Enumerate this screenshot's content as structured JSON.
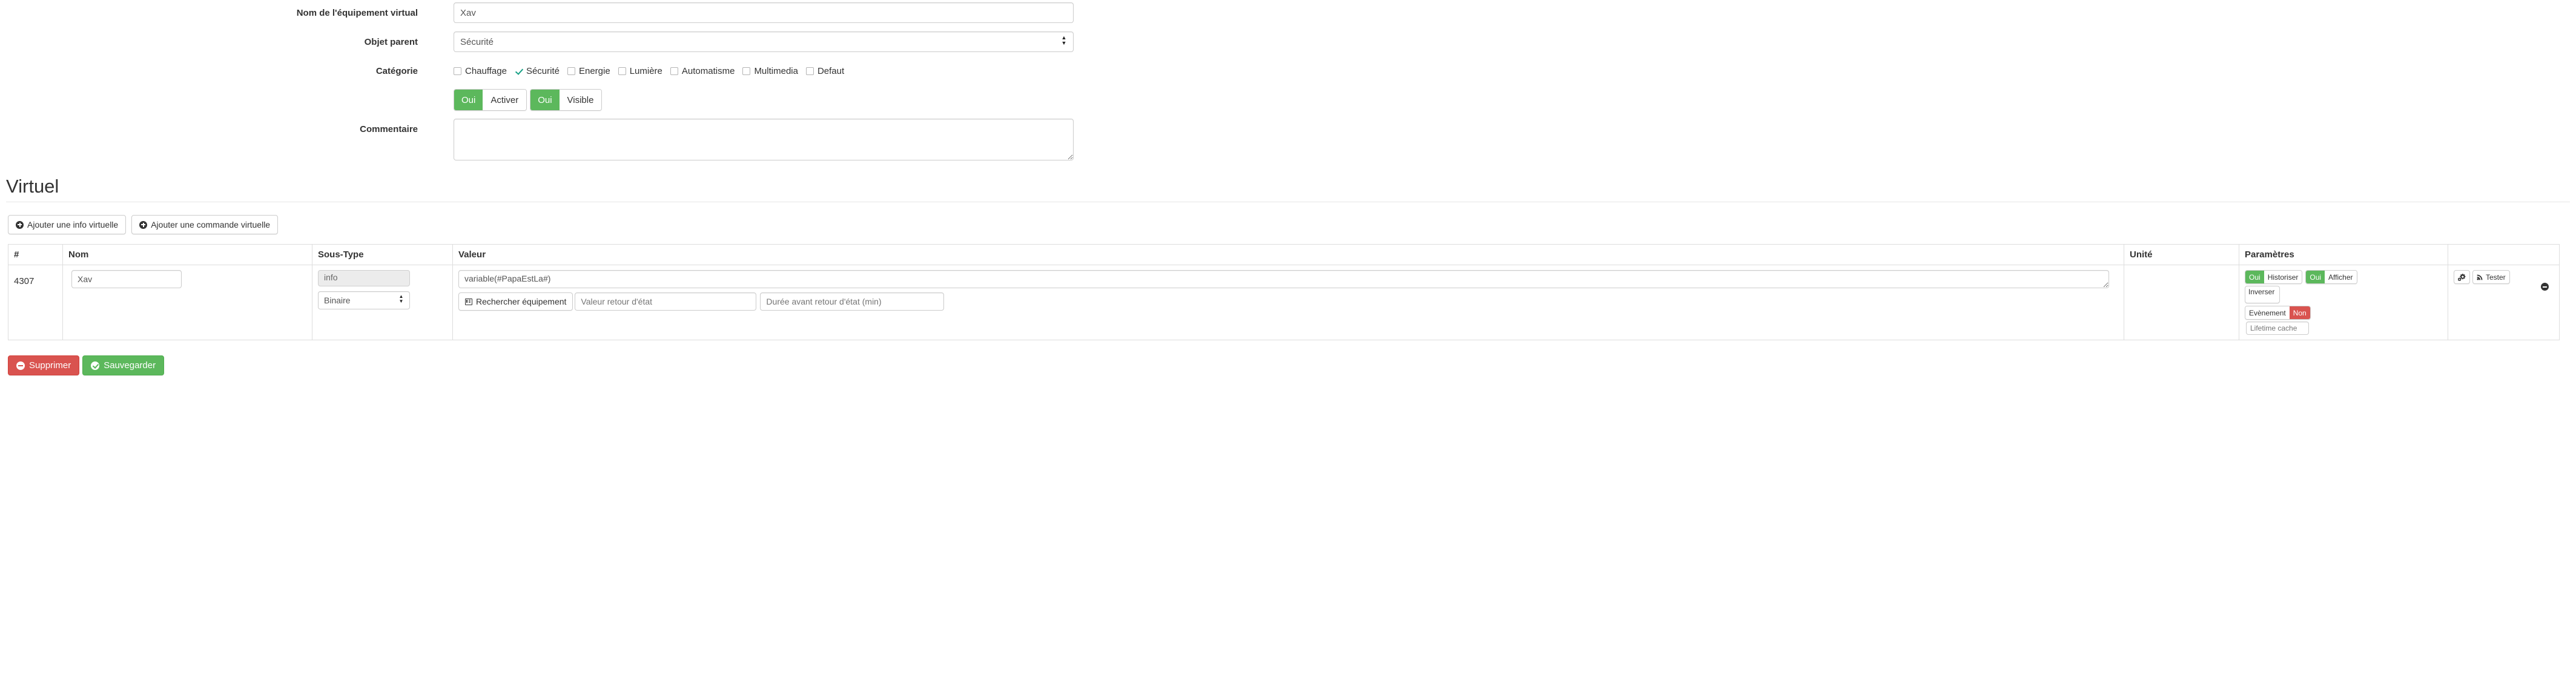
{
  "form": {
    "name_field": {
      "label": "Nom de l'équipement virtual",
      "value": "Xav",
      "placeholder": ""
    },
    "parent_field": {
      "label": "Objet parent",
      "value": "Sécurité"
    },
    "category_field": {
      "label": "Catégorie",
      "items": [
        {
          "label": "Chauffage",
          "checked": false
        },
        {
          "label": "Sécurité",
          "checked": true
        },
        {
          "label": "Energie",
          "checked": false
        },
        {
          "label": "Lumière",
          "checked": false
        },
        {
          "label": "Automatisme",
          "checked": false
        },
        {
          "label": "Multimedia",
          "checked": false
        },
        {
          "label": "Defaut",
          "checked": false
        }
      ]
    },
    "toggles": [
      {
        "state": "Oui",
        "label": "Activer"
      },
      {
        "state": "Oui",
        "label": "Visible"
      }
    ],
    "comment_field": {
      "label": "Commentaire",
      "value": "",
      "placeholder": ""
    }
  },
  "section": {
    "title": "Virtuel",
    "add_info_button": "Ajouter une info virtuelle",
    "add_command_button": "Ajouter une commande virtuelle"
  },
  "table": {
    "headers": [
      "#",
      "Nom",
      "Sous-Type",
      "Valeur",
      "Unité",
      "Paramètres",
      ""
    ],
    "rows": [
      {
        "id": "4307",
        "name": "Xav",
        "name_placeholder": "",
        "type_static": "info",
        "subtype": "Binaire",
        "value": "variable(#PapaEstLa#)",
        "search_button": "Rechercher équipement",
        "return_value_placeholder": "Valeur retour d'état",
        "duration_placeholder": "Durée avant retour d'état (min)",
        "unit": "",
        "params": {
          "historiser": {
            "state": "Oui",
            "label": "Historiser"
          },
          "afficher": {
            "state": "Oui",
            "label": "Afficher"
          },
          "inverser_label": "Inverser",
          "evenement": {
            "label": "Evènement",
            "state": "Non"
          },
          "lifetime_placeholder": "Lifetime cache"
        },
        "actions": {
          "config_icon": "gears-icon",
          "test_button": "Tester",
          "remove_icon": "minus-circle-icon"
        }
      }
    ]
  },
  "footer": {
    "delete_button": "Supprimer",
    "save_button": "Sauvegarder"
  },
  "colors": {
    "green": "#5cb85c",
    "red": "#d9534f",
    "check_teal": "#16a085",
    "border": "#cccccc",
    "table_border": "#dddddd"
  }
}
